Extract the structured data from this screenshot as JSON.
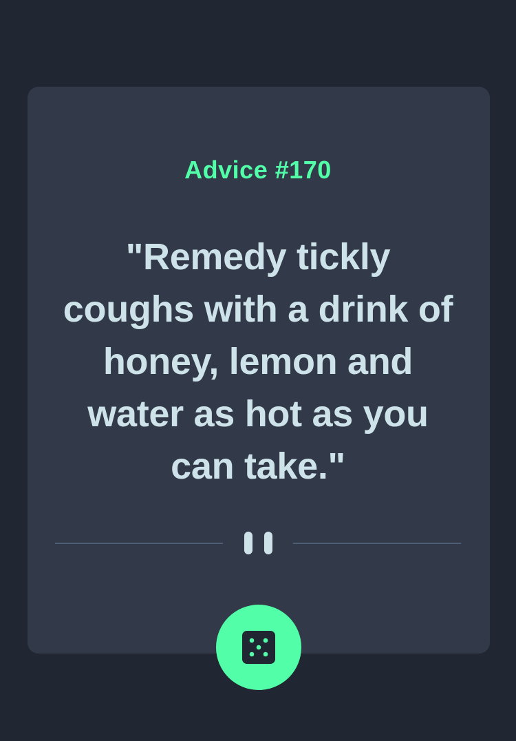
{
  "advice": {
    "id_label": "Advice #170",
    "quote": "\"Remedy tickly coughs with a drink of honey, lemon and water as hot as you can take.\""
  },
  "icons": {
    "divider": "pause-icon",
    "button": "dice-icon"
  },
  "colors": {
    "background": "#202632",
    "card": "#323a49",
    "accent": "#52ffa8",
    "text": "#cee3e9",
    "divider": "#4f5d74"
  }
}
